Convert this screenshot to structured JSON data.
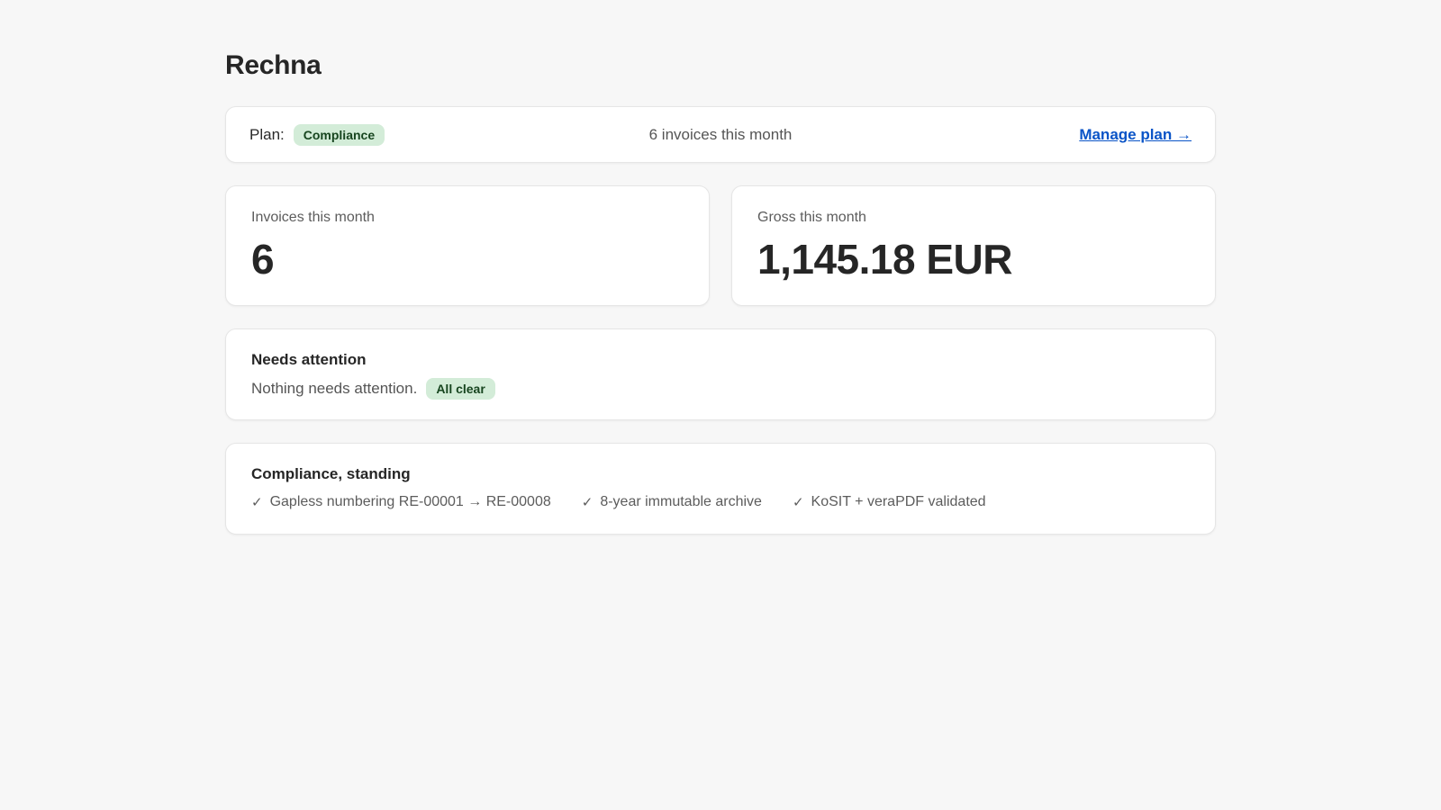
{
  "app": {
    "title": "Rechna"
  },
  "plan_bar": {
    "plan_label": "Plan:",
    "plan_badge": "Compliance",
    "summary": "6 invoices this month",
    "manage_link": "Manage plan →"
  },
  "stats": [
    {
      "label": "Invoices this month",
      "value": "6"
    },
    {
      "label": "Gross this month",
      "value": "1,145.18 EUR"
    }
  ],
  "attention": {
    "title": "Needs attention",
    "message": "Nothing needs attention.",
    "badge": "All clear"
  },
  "compliance": {
    "title": "Compliance, standing",
    "items": [
      {
        "icon": "check-icon",
        "text": "Gapless numbering RE-00001 → RE-00008"
      },
      {
        "icon": "check-icon",
        "text": "8-year immutable archive"
      },
      {
        "icon": "check-icon",
        "text": "KoSIT + veraPDF validated"
      }
    ]
  },
  "colors": {
    "background": "#f7f7f7",
    "badge_bg": "#d3ecd8",
    "badge_text": "#17451f",
    "link": "#0a54c7"
  }
}
